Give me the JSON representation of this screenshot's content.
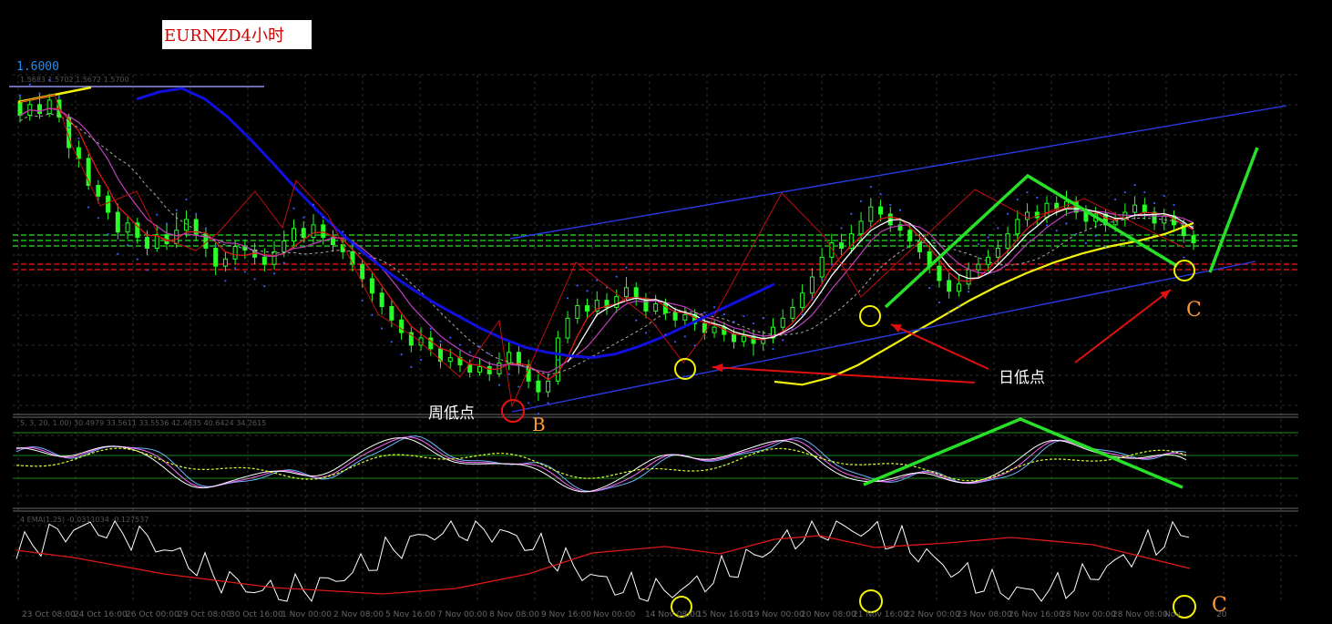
{
  "title": "EURNZD4小时",
  "price_label": "1.6000",
  "price_info": "1.5683 1.5702 1.5672 1.5700",
  "stoch_info": "5, 3, 20, 1.00) 30.4979 33.5611 33.5536 42.4635 40.6424 34.2615",
  "ema_info": "4 EMA(1.25) -0.0311034 -0.127537",
  "annotations": {
    "weekly_low": "周低点",
    "daily_low": "日低点",
    "point_b": "B",
    "point_c_main": "C",
    "point_c_lower": "C"
  },
  "x_axis_labels": [
    "23 Oct 08:00",
    "24 Oct 16:00",
    "26 Oct 00:00",
    "29 Oct 08:00",
    "30 Oct 16:00",
    "1 Nov 00:00",
    "2 Nov 08:00",
    "5 Nov 16:00",
    "7 Nov 00:00",
    "8 Nov 08:00",
    "9 Nov 16:00",
    "Nov 00:00",
    "14 Nov 08:00",
    "15 Nov 16:00",
    "19 Nov 00:00",
    "20 Nov 08:00",
    "21 Nov 16:00",
    "22 Nov 00:00",
    "23 Nov 08:00",
    "26 Nov 16:00",
    "28 Nov 00:00",
    "28 Nov 08:00",
    "Nov",
    "20"
  ],
  "colors": {
    "bull": "#27ff27",
    "bear": "#27ff27",
    "ma_blue": "#1010e0",
    "ma_yellow": "#f2f20a",
    "ma_red": "#e21818",
    "grid": "#2e2e2e",
    "annot_green": "#28e028",
    "circle_yellow": "#f5f500",
    "circle_red": "#f01010",
    "orange": "#ff9933"
  },
  "chart_data": {
    "type": "candlestick",
    "price_axis": {
      "label": "1.6000"
    },
    "candles": [
      [
        1.5702,
        1.5688,
        1.571,
        1.568
      ],
      [
        1.5688,
        1.57,
        1.5706,
        1.5682
      ],
      [
        1.57,
        1.569,
        1.5712,
        1.5684
      ],
      [
        1.569,
        1.5705,
        1.5712,
        1.5686
      ],
      [
        1.5705,
        1.5686,
        1.5712,
        1.568
      ],
      [
        1.5686,
        1.5652,
        1.569,
        1.564
      ],
      [
        1.5652,
        1.564,
        1.566,
        1.563
      ],
      [
        1.564,
        1.561,
        1.5645,
        1.5605
      ],
      [
        1.561,
        1.5598,
        1.5616,
        1.559
      ],
      [
        1.5598,
        1.558,
        1.5604,
        1.5572
      ],
      [
        1.558,
        1.5558,
        1.559,
        1.555
      ],
      [
        1.5558,
        1.5568,
        1.5575,
        1.555
      ],
      [
        1.5568,
        1.5552,
        1.5574,
        1.5545
      ],
      [
        1.5552,
        1.554,
        1.556,
        1.5532
      ],
      [
        1.554,
        1.5555,
        1.5566,
        1.5536
      ],
      [
        1.5555,
        1.5545,
        1.5568,
        1.5538
      ],
      [
        1.5545,
        1.556,
        1.558,
        1.554
      ],
      [
        1.556,
        1.5572,
        1.5582,
        1.5552
      ],
      [
        1.5572,
        1.5556,
        1.5578,
        1.5548
      ],
      [
        1.5556,
        1.554,
        1.5562,
        1.553
      ],
      [
        1.554,
        1.552,
        1.5546,
        1.551
      ],
      [
        1.552,
        1.5528,
        1.5536,
        1.5514
      ],
      [
        1.5528,
        1.5542,
        1.5548,
        1.5522
      ],
      [
        1.5542,
        1.5538,
        1.555,
        1.5528
      ],
      [
        1.5538,
        1.553,
        1.5546,
        1.5522
      ],
      [
        1.553,
        1.5522,
        1.554,
        1.5514
      ],
      [
        1.5522,
        1.5536,
        1.5548,
        1.5516
      ],
      [
        1.5536,
        1.5548,
        1.556,
        1.553
      ],
      [
        1.5548,
        1.5562,
        1.5572,
        1.554
      ],
      [
        1.5562,
        1.5552,
        1.557,
        1.5546
      ],
      [
        1.5552,
        1.5566,
        1.5578,
        1.5544
      ],
      [
        1.5566,
        1.5552,
        1.5572,
        1.5544
      ],
      [
        1.5552,
        1.5544,
        1.556,
        1.5536
      ],
      [
        1.5544,
        1.5536,
        1.5552,
        1.5528
      ],
      [
        1.5536,
        1.5522,
        1.5542,
        1.5514
      ],
      [
        1.5522,
        1.5506,
        1.5528,
        1.5496
      ],
      [
        1.5506,
        1.549,
        1.5512,
        1.548
      ],
      [
        1.549,
        1.5475,
        1.5496,
        1.5466
      ],
      [
        1.5475,
        1.546,
        1.5482,
        1.5452
      ],
      [
        1.546,
        1.5446,
        1.5466,
        1.5438
      ],
      [
        1.5446,
        1.5432,
        1.5452,
        1.5424
      ],
      [
        1.5432,
        1.544,
        1.5452,
        1.5426
      ],
      [
        1.544,
        1.5428,
        1.5448,
        1.542
      ],
      [
        1.5428,
        1.5414,
        1.5434,
        1.5406
      ],
      [
        1.5414,
        1.5418,
        1.5428,
        1.5406
      ],
      [
        1.5418,
        1.541,
        1.5426,
        1.5402
      ],
      [
        1.541,
        1.5402,
        1.5416,
        1.5396
      ],
      [
        1.5402,
        1.5408,
        1.5418,
        1.5398
      ],
      [
        1.5408,
        1.54,
        1.5414,
        1.5392
      ],
      [
        1.54,
        1.5412,
        1.5424,
        1.5396
      ],
      [
        1.5412,
        1.5424,
        1.5436,
        1.5404
      ],
      [
        1.5424,
        1.541,
        1.5432,
        1.54
      ],
      [
        1.541,
        1.5392,
        1.5416,
        1.5384
      ],
      [
        1.5392,
        1.538,
        1.54,
        1.537
      ],
      [
        1.538,
        1.5392,
        1.54,
        1.5374
      ],
      [
        1.5392,
        1.544,
        1.5448,
        1.5388
      ],
      [
        1.544,
        1.5462,
        1.547,
        1.5434
      ],
      [
        1.5462,
        1.5476,
        1.5484,
        1.5456
      ],
      [
        1.5476,
        1.547,
        1.5484,
        1.5462
      ],
      [
        1.547,
        1.5482,
        1.5492,
        1.5464
      ],
      [
        1.5482,
        1.5474,
        1.549,
        1.5466
      ],
      [
        1.5474,
        1.5486,
        1.5494,
        1.5468
      ],
      [
        1.5486,
        1.5496,
        1.5508,
        1.548
      ],
      [
        1.5496,
        1.5484,
        1.5502,
        1.5476
      ],
      [
        1.5484,
        1.547,
        1.549,
        1.5462
      ],
      [
        1.547,
        1.5478,
        1.5488,
        1.5466
      ],
      [
        1.5478,
        1.5468,
        1.5484,
        1.546
      ],
      [
        1.5468,
        1.546,
        1.5474,
        1.5452
      ],
      [
        1.546,
        1.5466,
        1.5474,
        1.5454
      ],
      [
        1.5466,
        1.5456,
        1.5472,
        1.5448
      ],
      [
        1.5456,
        1.5446,
        1.5462,
        1.5438
      ],
      [
        1.5446,
        1.5452,
        1.546,
        1.544
      ],
      [
        1.5452,
        1.5444,
        1.5458,
        1.5436
      ],
      [
        1.5444,
        1.5436,
        1.545,
        1.5428
      ],
      [
        1.5436,
        1.5442,
        1.545,
        1.543
      ],
      [
        1.5442,
        1.5434,
        1.5448,
        1.542
      ],
      [
        1.5434,
        1.544,
        1.5448,
        1.5426
      ],
      [
        1.544,
        1.5452,
        1.5462,
        1.5434
      ],
      [
        1.5452,
        1.5462,
        1.5472,
        1.5446
      ],
      [
        1.5462,
        1.5474,
        1.5484,
        1.5456
      ],
      [
        1.5474,
        1.549,
        1.55,
        1.5468
      ],
      [
        1.549,
        1.5508,
        1.5518,
        1.5482
      ],
      [
        1.5508,
        1.553,
        1.554,
        1.55
      ],
      [
        1.553,
        1.5546,
        1.5556,
        1.5522
      ],
      [
        1.5546,
        1.554,
        1.5556,
        1.5532
      ],
      [
        1.554,
        1.5556,
        1.5566,
        1.5534
      ],
      [
        1.5556,
        1.557,
        1.558,
        1.5548
      ],
      [
        1.557,
        1.5586,
        1.5596,
        1.5562
      ],
      [
        1.5586,
        1.5578,
        1.5594,
        1.557
      ],
      [
        1.5578,
        1.5566,
        1.5586,
        1.5558
      ],
      [
        1.5566,
        1.556,
        1.5574,
        1.5552
      ],
      [
        1.556,
        1.5548,
        1.5566,
        1.554
      ],
      [
        1.5548,
        1.5536,
        1.5556,
        1.5528
      ],
      [
        1.5536,
        1.552,
        1.5544,
        1.5512
      ],
      [
        1.552,
        1.5504,
        1.5528,
        1.5496
      ],
      [
        1.5504,
        1.5492,
        1.5512,
        1.5484
      ],
      [
        1.5492,
        1.55,
        1.551,
        1.5486
      ],
      [
        1.55,
        1.5516,
        1.5524,
        1.5494
      ],
      [
        1.5516,
        1.5522,
        1.553,
        1.5508
      ],
      [
        1.5522,
        1.553,
        1.5538,
        1.5514
      ],
      [
        1.553,
        1.554,
        1.5548,
        1.5522
      ],
      [
        1.554,
        1.5556,
        1.5564,
        1.5532
      ],
      [
        1.5556,
        1.5572,
        1.5582,
        1.5548
      ],
      [
        1.5572,
        1.558,
        1.559,
        1.5564
      ],
      [
        1.558,
        1.5574,
        1.5588,
        1.5566
      ],
      [
        1.5574,
        1.559,
        1.5598,
        1.5568
      ],
      [
        1.559,
        1.5584,
        1.5598,
        1.5576
      ],
      [
        1.5584,
        1.5592,
        1.5604,
        1.5576
      ],
      [
        1.5592,
        1.558,
        1.5598,
        1.5572
      ],
      [
        1.558,
        1.557,
        1.5588,
        1.556
      ],
      [
        1.557,
        1.5578,
        1.5586,
        1.5562
      ],
      [
        1.5578,
        1.5566,
        1.5584,
        1.5558
      ],
      [
        1.5566,
        1.5572,
        1.558,
        1.5558
      ],
      [
        1.5572,
        1.558,
        1.559,
        1.5564
      ],
      [
        1.558,
        1.5588,
        1.5598,
        1.5572
      ],
      [
        1.5588,
        1.558,
        1.5596,
        1.5572
      ],
      [
        1.558,
        1.5568,
        1.5586,
        1.556
      ],
      [
        1.5568,
        1.5576,
        1.5584,
        1.556
      ],
      [
        1.5576,
        1.5566,
        1.5582,
        1.5558
      ],
      [
        1.5566,
        1.5554,
        1.5572,
        1.5546
      ],
      [
        1.5554,
        1.5546,
        1.556,
        1.5538
      ]
    ],
    "ma_series": [
      {
        "values": [
          1.57,
          1.5708,
          1.5712,
          1.57,
          1.568,
          1.5655,
          1.5628,
          1.56,
          1.5574,
          1.555,
          1.5528,
          1.5508,
          1.549,
          1.5474,
          1.546,
          1.5446,
          1.5434,
          1.5424,
          1.5418,
          1.5414,
          1.5412,
          1.5416,
          1.5424,
          1.5434,
          1.5446,
          1.5458,
          1.547,
          1.5482,
          1.5494
        ]
      },
      {
        "values": [
          1.5386,
          1.5388,
          1.5396,
          1.541,
          1.5428,
          1.5446,
          1.5464,
          1.5482,
          1.5498,
          1.5512,
          1.5524,
          1.5534,
          1.5542,
          1.5548,
          1.5556,
          1.5568
        ]
      }
    ],
    "stochastic": {
      "levels": [
        80,
        50,
        20
      ]
    },
    "ema": {
      "label": "EMA(1.25)"
    }
  }
}
